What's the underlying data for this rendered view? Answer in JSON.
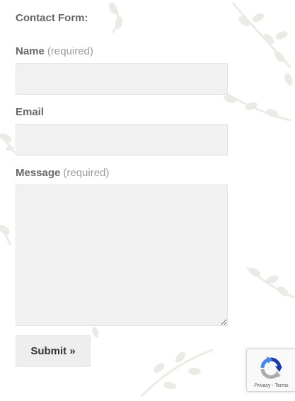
{
  "form": {
    "title": "Contact Form:",
    "fields": [
      {
        "label": "Name",
        "hint": "(required)",
        "value": ""
      },
      {
        "label": "Email",
        "hint": "",
        "value": ""
      },
      {
        "label": "Message",
        "hint": "(required)",
        "value": ""
      }
    ],
    "submit_label": "Submit »"
  },
  "recaptcha": {
    "icon": "recaptcha-icon",
    "privacy_label": "Privacy",
    "separator": "-",
    "terms_label": "Terms"
  },
  "colors": {
    "input_background": "#f1f1f1",
    "label_text": "#666666",
    "hint_text": "#9a9a9a",
    "recaptcha_blue": "#1c3aa9",
    "recaptcha_lightblue": "#4285f4",
    "recaptcha_gray": "#ababab"
  }
}
